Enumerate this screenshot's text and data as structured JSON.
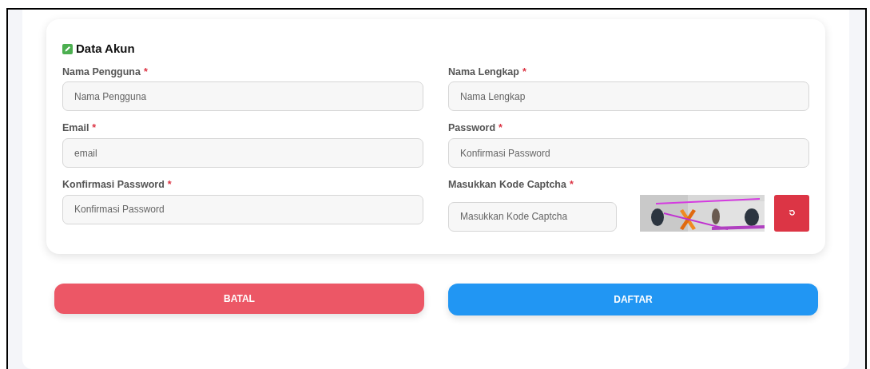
{
  "section": {
    "title": "Data Akun"
  },
  "fields": [
    {
      "kind": "text",
      "label": "Nama Pengguna",
      "required_mark": "*",
      "placeholder": "Nama Pengguna"
    },
    {
      "kind": "text",
      "label": "Nama Lengkap",
      "required_mark": "*",
      "placeholder": "Nama Lengkap"
    },
    {
      "kind": "text",
      "label": "Email",
      "required_mark": "*",
      "placeholder": "email"
    },
    {
      "kind": "text",
      "label": "Password",
      "required_mark": "*",
      "placeholder": "Konfirmasi Password"
    },
    {
      "kind": "text",
      "label": "Konfirmasi Password",
      "required_mark": "*",
      "placeholder": "Konfirmasi Password"
    },
    {
      "kind": "captcha",
      "label": "Masukkan Kode Captcha",
      "required_mark": "*",
      "placeholder": "Masukkan Kode Captcha"
    }
  ],
  "buttons": [
    {
      "label": "BATAL",
      "kind": "cancel"
    },
    {
      "label": "DAFTAR",
      "kind": "submit"
    }
  ]
}
